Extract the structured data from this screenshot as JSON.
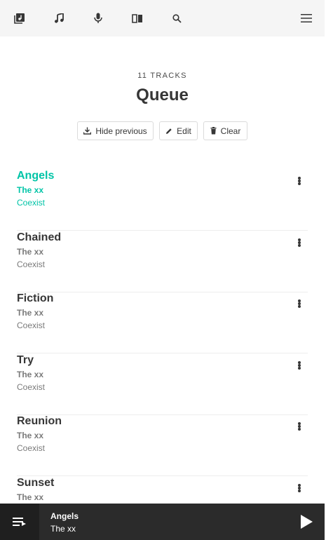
{
  "nav": {
    "icons": [
      "library-icon",
      "music-note-icon",
      "microphone-icon",
      "book-icon",
      "search-icon",
      "menu-icon"
    ]
  },
  "queue": {
    "count_label": "11 TRACKS",
    "title": "Queue",
    "actions": {
      "hide_previous": "Hide previous",
      "edit": "Edit",
      "clear": "Clear"
    }
  },
  "tracks": [
    {
      "title": "Angels",
      "artist": "The xx",
      "album": "Coexist",
      "active": true
    },
    {
      "title": "Chained",
      "artist": "The xx",
      "album": "Coexist"
    },
    {
      "title": "Fiction",
      "artist": "The xx",
      "album": "Coexist"
    },
    {
      "title": "Try",
      "artist": "The xx",
      "album": "Coexist"
    },
    {
      "title": "Reunion",
      "artist": "The xx",
      "album": "Coexist"
    },
    {
      "title": "Sunset",
      "artist": "The xx",
      "album": ""
    }
  ],
  "now_playing": {
    "title": "Angels",
    "artist": "The xx"
  },
  "colors": {
    "accent": "#00c4a7",
    "topbar": "#f5f5f5",
    "player": "#2b2b2b"
  }
}
